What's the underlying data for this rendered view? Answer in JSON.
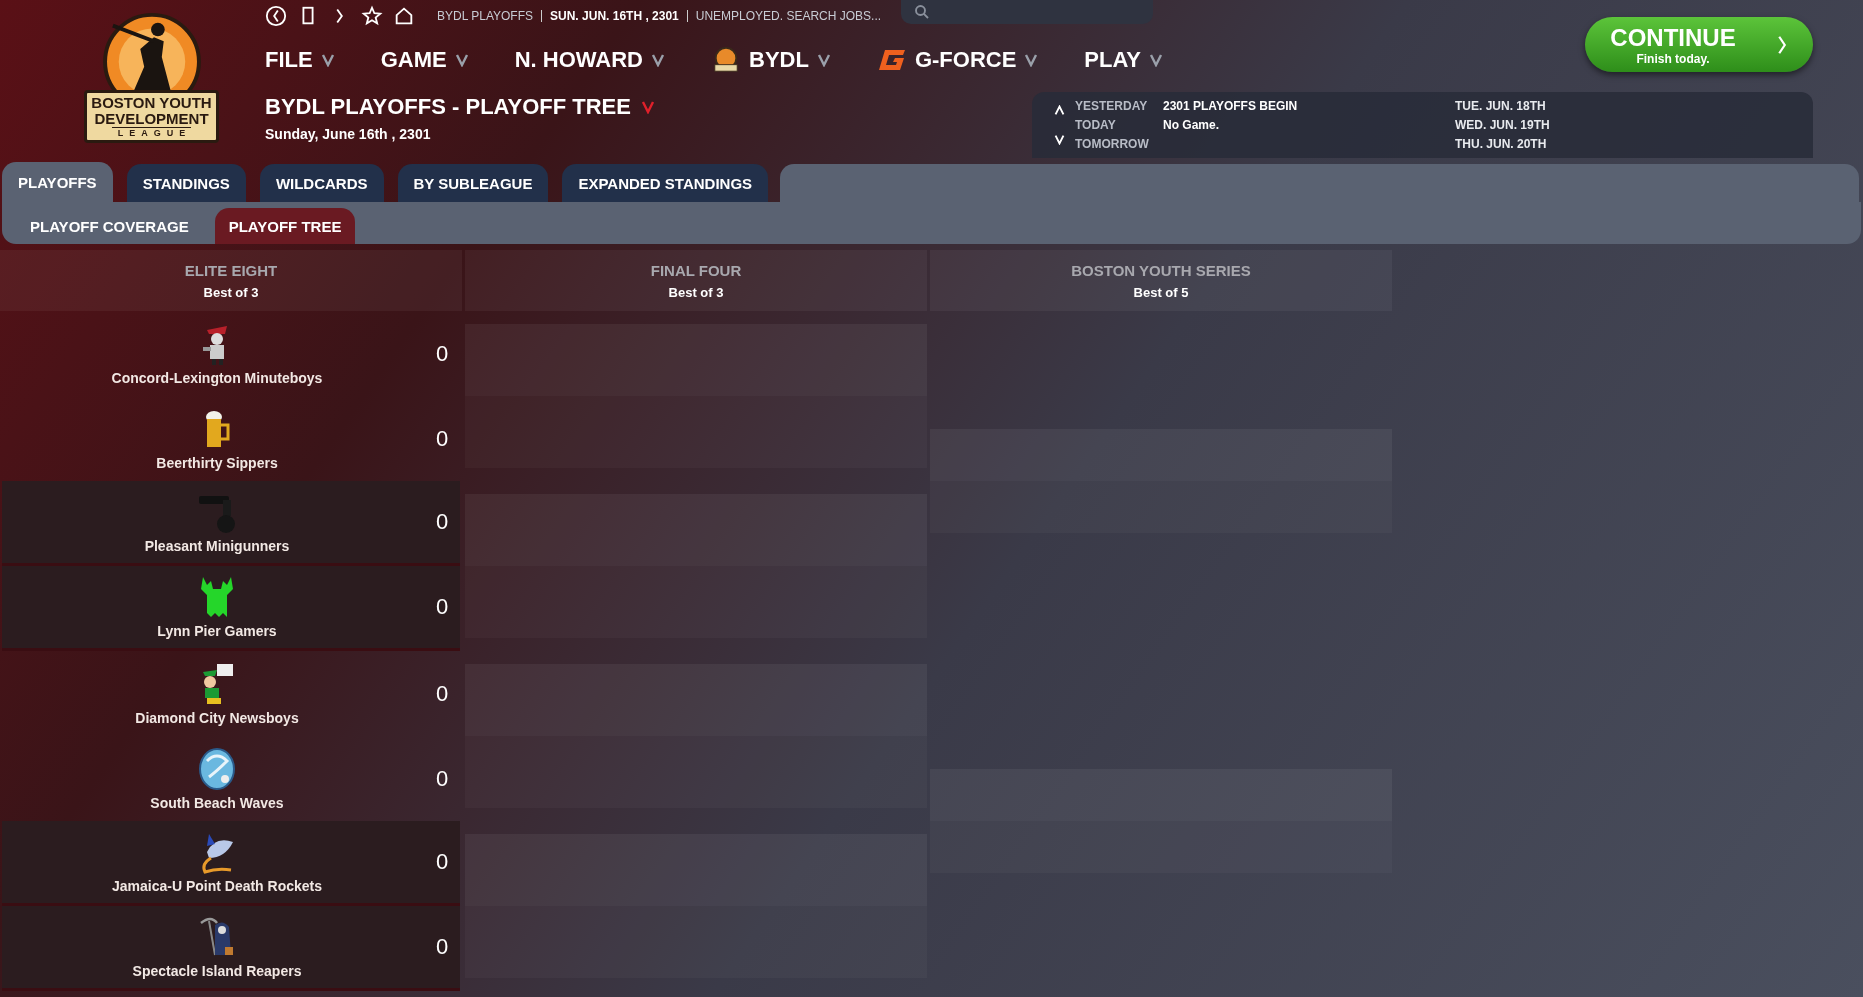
{
  "logo": {
    "lines": [
      "BOSTON YOUTH",
      "DEVELOPMENT"
    ],
    "footer": "LEAGUE"
  },
  "nav": {
    "breadcrumb": [
      "BYDL PLAYOFFS",
      "SUN. JUN. 16TH , 2301",
      "UNEMPLOYED. SEARCH JOBS..."
    ]
  },
  "menu": [
    {
      "label": "FILE",
      "kind": "plain"
    },
    {
      "label": "GAME",
      "kind": "plain"
    },
    {
      "label": "N. HOWARD",
      "kind": "plain"
    },
    {
      "label": "BYDL",
      "kind": "league"
    },
    {
      "label": "G-FORCE",
      "kind": "brand"
    },
    {
      "label": "PLAY",
      "kind": "plain"
    }
  ],
  "page": {
    "title": "BYDL PLAYOFFS - PLAYOFF TREE",
    "date": "Sunday, June 16th , 2301"
  },
  "continue": {
    "label": "CONTINUE",
    "sub": "Finish today."
  },
  "schedule": [
    {
      "day": "YESTERDAY",
      "event": "2301 PLAYOFFS BEGIN",
      "date": "TUE. JUN. 18TH"
    },
    {
      "day": "TODAY",
      "event": "No Game.",
      "date": "WED. JUN. 19TH"
    },
    {
      "day": "TOMORROW",
      "date": "THU. JUN. 20TH"
    }
  ],
  "tabs": [
    {
      "label": "PLAYOFFS",
      "selected": true
    },
    {
      "label": "STANDINGS",
      "selected": false
    },
    {
      "label": "WILDCARDS",
      "selected": false
    },
    {
      "label": "BY SUBLEAGUE",
      "selected": false
    },
    {
      "label": "EXPANDED STANDINGS",
      "selected": false
    }
  ],
  "subtabs": [
    {
      "label": "PLAYOFF COVERAGE",
      "selected": false
    },
    {
      "label": "PLAYOFF TREE",
      "selected": true
    }
  ],
  "rounds": [
    {
      "title": "ELITE EIGHT",
      "format": "Best of 3",
      "matchups": [
        {
          "kind": "teams",
          "teams": [
            {
              "name": "Concord-Lexington Minuteboys",
              "score": "0"
            },
            {
              "name": "Beerthirty Sippers",
              "score": "0"
            }
          ]
        },
        {
          "kind": "teams",
          "teams": [
            {
              "name": "Pleasant Minigunners",
              "score": "0"
            },
            {
              "name": "Lynn Pier Gamers",
              "score": "0"
            }
          ]
        },
        {
          "kind": "teams",
          "teams": [
            {
              "name": "Diamond City Newsboys",
              "score": "0"
            },
            {
              "name": "South Beach Waves",
              "score": "0"
            }
          ]
        },
        {
          "kind": "teams",
          "teams": [
            {
              "name": "Jamaica-U Point Death Rockets",
              "score": "0"
            },
            {
              "name": "Spectacle Island Reapers",
              "score": "0"
            }
          ]
        }
      ]
    },
    {
      "title": "FINAL FOUR",
      "format": "Best of 3",
      "matchups": [
        {
          "kind": "empty"
        },
        {
          "kind": "empty"
        },
        {
          "kind": "empty"
        },
        {
          "kind": "empty"
        }
      ]
    },
    {
      "title": "BOSTON YOUTH SERIES",
      "format": "Best of 5",
      "matchups": [
        {
          "kind": "empty"
        },
        {
          "kind": "empty"
        }
      ]
    }
  ]
}
